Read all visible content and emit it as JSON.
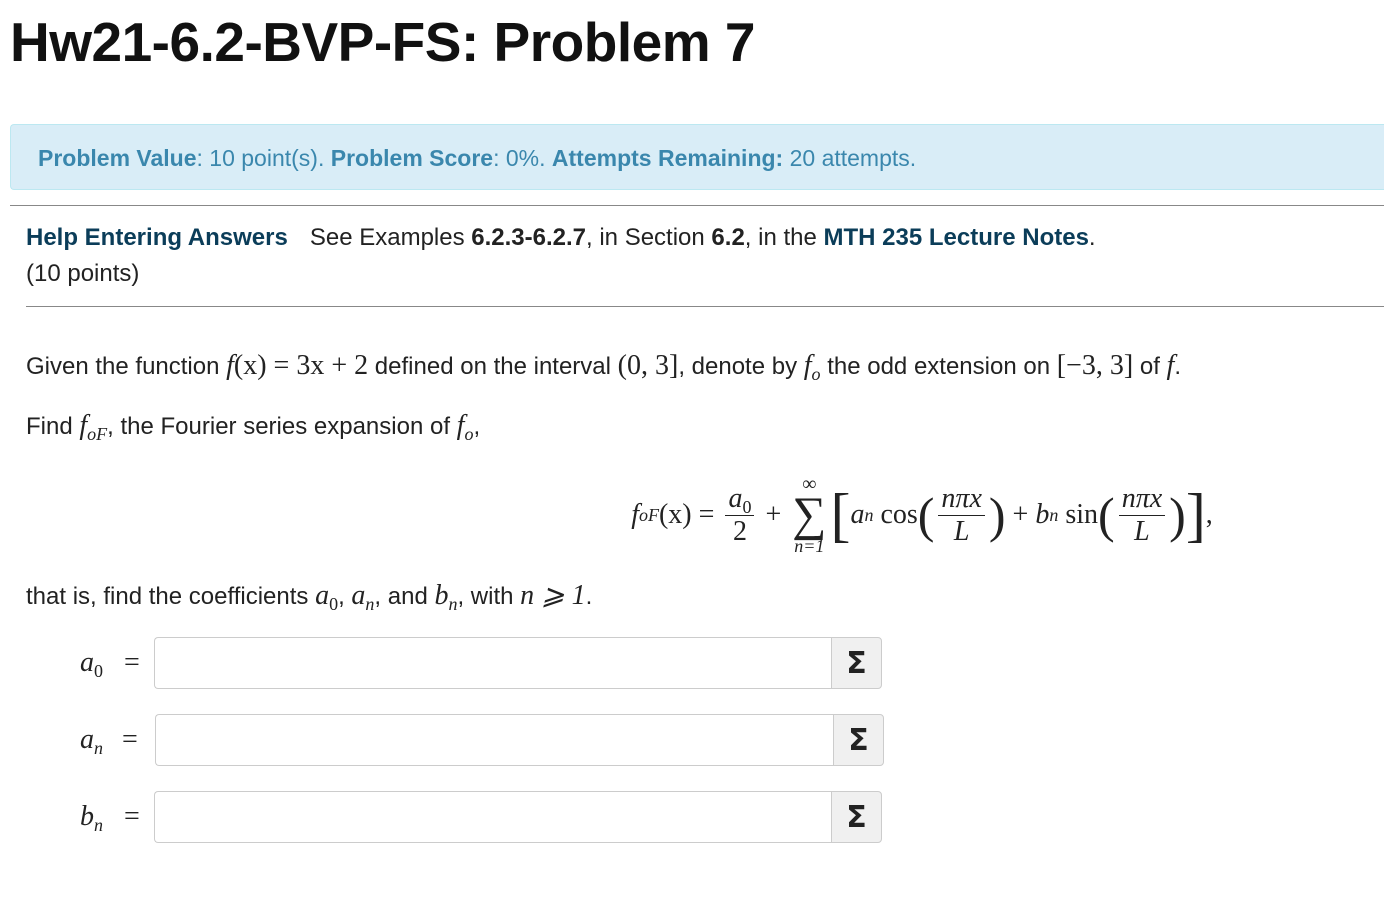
{
  "title": "Hw21-6.2-BVP-FS: Problem 7",
  "info": {
    "value_label": "Problem Value",
    "value_text": ": 10 point(s). ",
    "score_label": "Problem Score",
    "score_text": ": 0%. ",
    "attempts_label": "Attempts Remaining:",
    "attempts_text": " 20 attempts."
  },
  "help": {
    "link": "Help Entering Answers",
    "t1": "See Examples ",
    "b1": "6.2.3-6.2.7",
    "t2": ", in Section ",
    "b2": "6.2",
    "t3": ", in the ",
    "notes_link": "MTH 235 Lecture Notes",
    "t4": ".",
    "points": "(10 points)"
  },
  "problem": {
    "p1": "Given the function ",
    "fx": "f",
    "eq1": "(x) = 3x + 2",
    "p2": " defined on the interval ",
    "interval1": "(0, 3]",
    "p3": ", denote by ",
    "fo": "f",
    "fo_sub": "o",
    "p4": " the odd extension on ",
    "interval2": "[−3, 3]",
    "p5": " of ",
    "f_end": "f",
    "p6": ".",
    "find": "Find ",
    "foF": "f",
    "foF_sub": "oF",
    "find2": ", the Fourier series expansion of ",
    "fo2": "f",
    "fo2_sub": "o",
    "find3": ",",
    "that": "that is, find the coefficients ",
    "a0": "a",
    "a0_sub": "0",
    "c1": ", ",
    "an": "a",
    "an_sub": "n",
    "c2": ", and ",
    "bn": "b",
    "bn_sub": "n",
    "c3": ", with ",
    "cond": "n ⩾ 1",
    "c4": "."
  },
  "formula": {
    "lhs_f": "f",
    "lhs_sub": "oF",
    "lhs_arg": "(x)",
    "eq": " = ",
    "a0_num": "a",
    "a0_num_sub": "0",
    "den2": "2",
    "plus": " + ",
    "sum_top": "∞",
    "sum_sym": "∑",
    "sum_bot": "n=1",
    "lbr": "[",
    "an": "a",
    "an_sub": "n",
    "cos": " cos",
    "npix": "nπx",
    "L": "L",
    "plus2": " + ",
    "bn": "b",
    "bn_sub": "n",
    "sin": " sin",
    "rbr": "]",
    "comma": ","
  },
  "answers": [
    {
      "var": "a",
      "sub": "0",
      "eq": "=",
      "value": "",
      "button": "Σ"
    },
    {
      "var": "a",
      "sub": "n",
      "eq": "=",
      "value": "",
      "button": "Σ"
    },
    {
      "var": "b",
      "sub": "n",
      "eq": "=",
      "value": "",
      "button": "Σ"
    }
  ]
}
